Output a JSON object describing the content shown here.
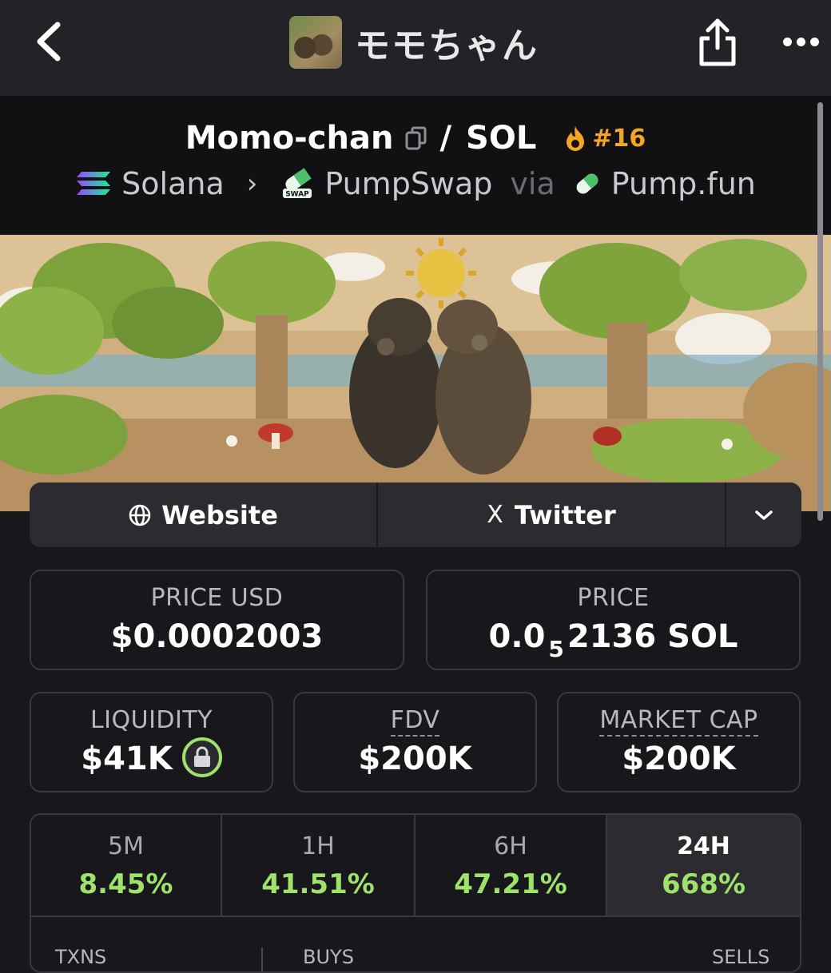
{
  "header": {
    "title": "モモちゃん"
  },
  "pair": {
    "base": "Momo-chan",
    "separator": "/",
    "quote": "SOL",
    "rank": "#16"
  },
  "chain": {
    "network": "Solana",
    "dex": "PumpSwap",
    "via": "via",
    "launchpad": "Pump.fun",
    "swap_badge": "SWAP"
  },
  "links": {
    "website": "Website",
    "twitter": "Twitter",
    "x_glyph": "X"
  },
  "price": {
    "usd_label": "PRICE USD",
    "usd_value": "$0.0002003",
    "native_label": "PRICE",
    "native_prefix": "0.0",
    "native_zeros": "5",
    "native_suffix": "2136 SOL"
  },
  "stats": {
    "liquidity_label": "LIQUIDITY",
    "liquidity_value": "$41K",
    "fdv_label": "FDV",
    "fdv_value": "$200K",
    "mcap_label": "MARKET CAP",
    "mcap_value": "$200K"
  },
  "changes": [
    {
      "label": "5M",
      "value": "8.45%"
    },
    {
      "label": "1H",
      "value": "41.51%"
    },
    {
      "label": "6H",
      "value": "47.21%"
    },
    {
      "label": "24H",
      "value": "668%"
    }
  ],
  "tx_headers": {
    "txns": "TXNS",
    "buys": "BUYS",
    "sells": "SELLS"
  },
  "colors": {
    "positive": "#9ee26b",
    "rank": "#f5a524",
    "background": "#18181c"
  },
  "icons": [
    "back-arrow-icon",
    "share-icon",
    "more-icon",
    "copy-icon",
    "flame-icon",
    "solana-icon",
    "pill-icon",
    "globe-icon",
    "x-logo-icon",
    "chevron-down-icon",
    "lock-icon"
  ]
}
